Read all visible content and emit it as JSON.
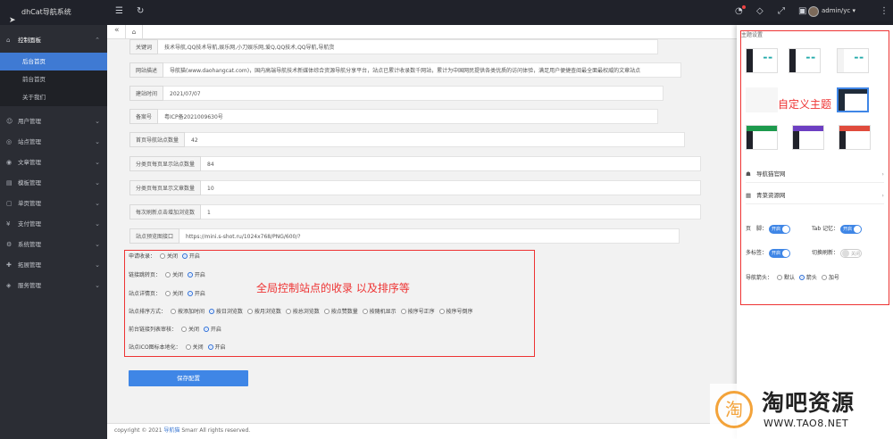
{
  "app": {
    "title": "dhCat导航系统",
    "user": "admin/yc"
  },
  "sidebar": {
    "section": "控制面板",
    "subs": [
      "后台首页",
      "前台首页",
      "关于我们"
    ],
    "items": [
      "用户管理",
      "站点管理",
      "文章管理",
      "模板管理",
      "单页管理",
      "支付管理",
      "系统管理",
      "拓展管理",
      "服务管理"
    ]
  },
  "form": {
    "rows": [
      {
        "label": "关键词",
        "value": "技术导航,QQ技术导航,娱乐网,小刀娱乐网,爱Q,QQ技术,QQ导航,导航货"
      },
      {
        "label": "网站描述",
        "value": "导航猫(www.daohangcat.com)，国内高端导航技术新媒体综合资源导航分享平台，站点已累计收录数千网站，累计为中国网民提供各类优质的访问体验，满足用户便捷查阅最全面最权威的文章站点"
      },
      {
        "label": "建站时间",
        "value": "2021/07/07"
      },
      {
        "label": "备案号",
        "value": "粤ICP备2021009630号"
      },
      {
        "label": "首页导航站点数量",
        "value": "42"
      },
      {
        "label": "分类页每页显示站点数量",
        "value": "84"
      },
      {
        "label": "分类页每页显示文章数量",
        "value": "10"
      },
      {
        "label": "每次刷新点击增加浏览数",
        "value": "1"
      },
      {
        "label": "站点预览图接口",
        "value": "https://mini.s-shot.ru/1024x768/PNG/600/?"
      }
    ],
    "toggles": [
      {
        "label": "申请收录：",
        "options": [
          "关闭",
          "开启"
        ],
        "selected": 1
      },
      {
        "label": "链接跳转页：",
        "options": [
          "关闭",
          "开启"
        ],
        "selected": 1
      },
      {
        "label": "站点详情页：",
        "options": [
          "关闭",
          "开启"
        ],
        "selected": 1
      },
      {
        "label": "站点排序方式：",
        "options": [
          "按添加时间",
          "按日浏览数",
          "按月浏览数",
          "按总浏览数",
          "按点赞数量",
          "按随机显示",
          "按序号正序",
          "按序号倒序"
        ],
        "selected": 1
      },
      {
        "label": "前台链接列表审核：",
        "options": [
          "关闭",
          "开启"
        ],
        "selected": 1
      },
      {
        "label": "站点ICO图标本地化：",
        "options": [
          "关闭",
          "开启"
        ],
        "selected": 1
      }
    ],
    "annotation": "全局控制站点的收录 以及排序等",
    "save_label": "保存配置"
  },
  "footer": {
    "text": "copyright © 2021 ",
    "link": "导航猫",
    "rest": " Smarr All rights reserved."
  },
  "panel": {
    "title": "主题设置",
    "annotation": "自定义主题",
    "links": [
      "导航猫官网",
      "青菜资源网"
    ],
    "footer_label": "页　脚：",
    "footer_on": "开启",
    "tab_label": "Tab 记忆：",
    "tab_on": "开启",
    "multi_label": "多标签：",
    "multi_on": "开启",
    "refresh_label": "切换刷新：",
    "refresh_off": "关闭",
    "nav_label": "导航箭头：",
    "nav_options": [
      "默认",
      "箭头",
      "加号"
    ],
    "nav_selected": 1
  },
  "watermark": {
    "title": "淘吧资源",
    "url": "WWW.TAO8.NET",
    "logo": "淘"
  }
}
